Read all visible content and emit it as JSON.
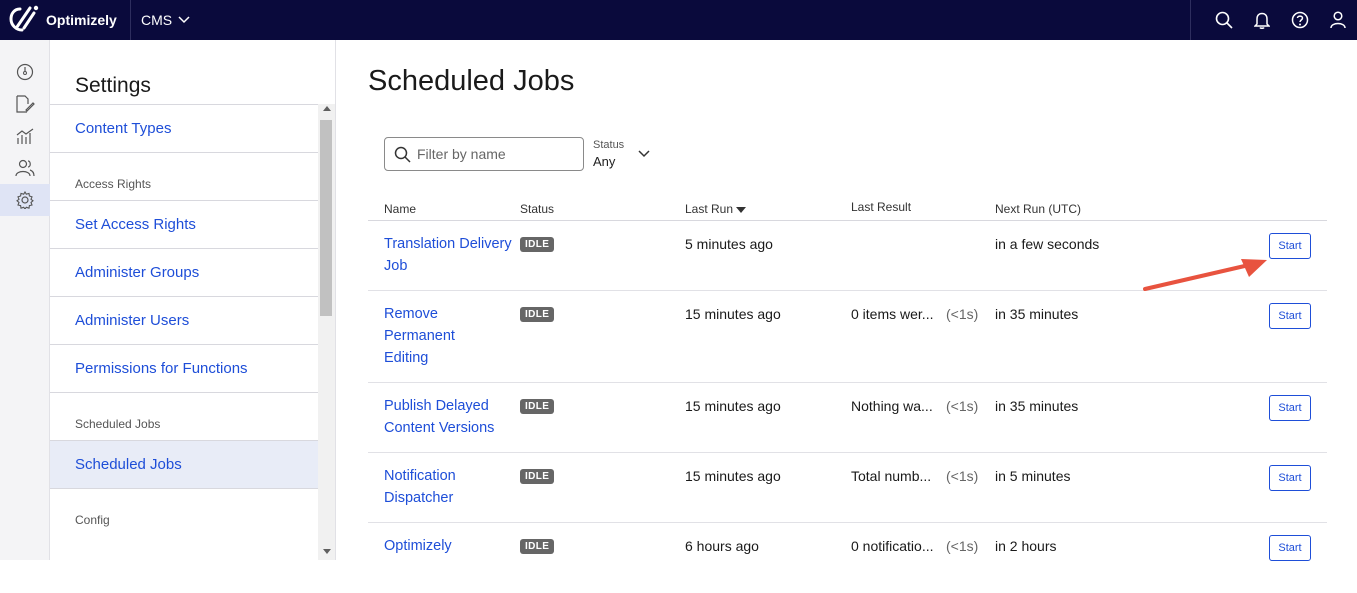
{
  "header": {
    "brand": "Optimizely",
    "product": "CMS",
    "icons": [
      "search-icon",
      "bell-icon",
      "help-icon",
      "user-icon"
    ]
  },
  "rail": {
    "icons": [
      "dashboard-icon",
      "edit-icon",
      "reports-icon",
      "users-icon",
      "settings-icon"
    ]
  },
  "settings": {
    "title": "Settings",
    "items": [
      {
        "type": "link",
        "label": "Content Types"
      },
      {
        "type": "group",
        "label": "Access Rights"
      },
      {
        "type": "link",
        "label": "Set Access Rights"
      },
      {
        "type": "link",
        "label": "Administer Groups"
      },
      {
        "type": "link",
        "label": "Administer Users"
      },
      {
        "type": "link",
        "label": "Permissions for Functions"
      },
      {
        "type": "group",
        "label": "Scheduled Jobs"
      },
      {
        "type": "link",
        "label": "Scheduled Jobs",
        "active": true
      },
      {
        "type": "group",
        "label": "Config"
      }
    ]
  },
  "main": {
    "title": "Scheduled Jobs",
    "filter_placeholder": "Filter by name",
    "status_label": "Status",
    "status_value": "Any",
    "columns": {
      "name": "Name",
      "status": "Status",
      "last_run": "Last Run",
      "last_result": "Last Result",
      "next_run": "Next Run (UTC)"
    },
    "start_label": "Start",
    "rows": [
      {
        "name": "Translation Delivery Job",
        "status": "IDLE",
        "last_run": "5 minutes ago",
        "last_result": "",
        "duration": "",
        "next_run": "in a few seconds"
      },
      {
        "name": "Remove Permanent Editing",
        "status": "IDLE",
        "last_run": "15 minutes ago",
        "last_result": "0 items wer...",
        "duration": "(<1s)",
        "next_run": "in 35 minutes"
      },
      {
        "name": "Publish Delayed Content Versions",
        "status": "IDLE",
        "last_run": "15 minutes ago",
        "last_result": "Nothing wa...",
        "duration": "(<1s)",
        "next_run": "in 35 minutes"
      },
      {
        "name": "Notification Dispatcher",
        "status": "IDLE",
        "last_run": "15 minutes ago",
        "last_result": "Total numb...",
        "duration": "(<1s)",
        "next_run": "in 5 minutes"
      },
      {
        "name": "Optimizely",
        "status": "IDLE",
        "last_run": "6 hours ago",
        "last_result": "0 notificatio...",
        "duration": "(<1s)",
        "next_run": "in 2 hours"
      }
    ]
  },
  "colors": {
    "topbar": "#0a0a3c",
    "link": "#1e4ed8",
    "arrow": "#e8533f"
  }
}
